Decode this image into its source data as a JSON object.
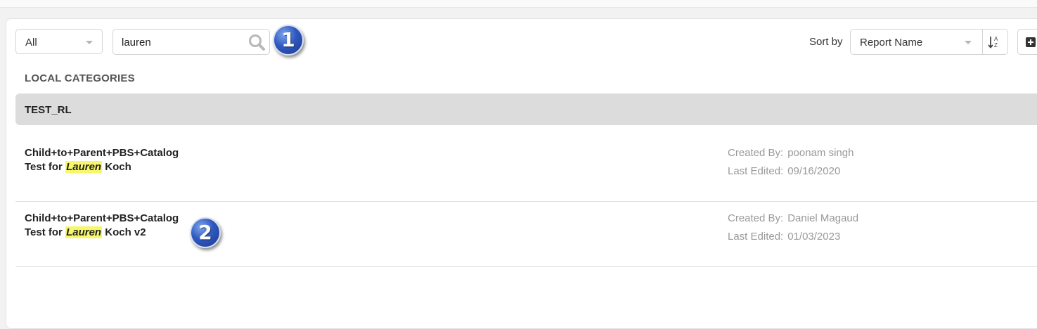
{
  "filter": {
    "selected": "All"
  },
  "search": {
    "value": "lauren",
    "placeholder": ""
  },
  "callouts": [
    "1",
    "2"
  ],
  "sort": {
    "label": "Sort by",
    "selected": "Report Name"
  },
  "section_title": "LOCAL CATEGORIES",
  "category": {
    "name": "TEST_RL"
  },
  "reports": [
    {
      "line1": "Child+to+Parent+PBS+Catalog",
      "line2_prefix": "Test for ",
      "line2_highlight": "Lauren",
      "line2_suffix": " Koch",
      "created_by_label": "Created By:",
      "created_by": "poonam singh",
      "last_edited_label": "Last Edited:",
      "last_edited": "09/16/2020"
    },
    {
      "line1": "Child+to+Parent+PBS+Catalog",
      "line2_prefix": "Test for ",
      "line2_highlight": "Lauren",
      "line2_suffix": " Koch v2",
      "created_by_label": "Created By:",
      "created_by": "Daniel Magaud",
      "last_edited_label": "Last Edited:",
      "last_edited": "01/03/2023"
    }
  ],
  "icons": {
    "search": "search-icon",
    "sort_order": "sort-ascending-icon",
    "add": "add-icon"
  },
  "colors": {
    "highlight": "#f7f76a",
    "category_bg": "#dcdcdc",
    "callout_blue": "#2f58c0"
  }
}
